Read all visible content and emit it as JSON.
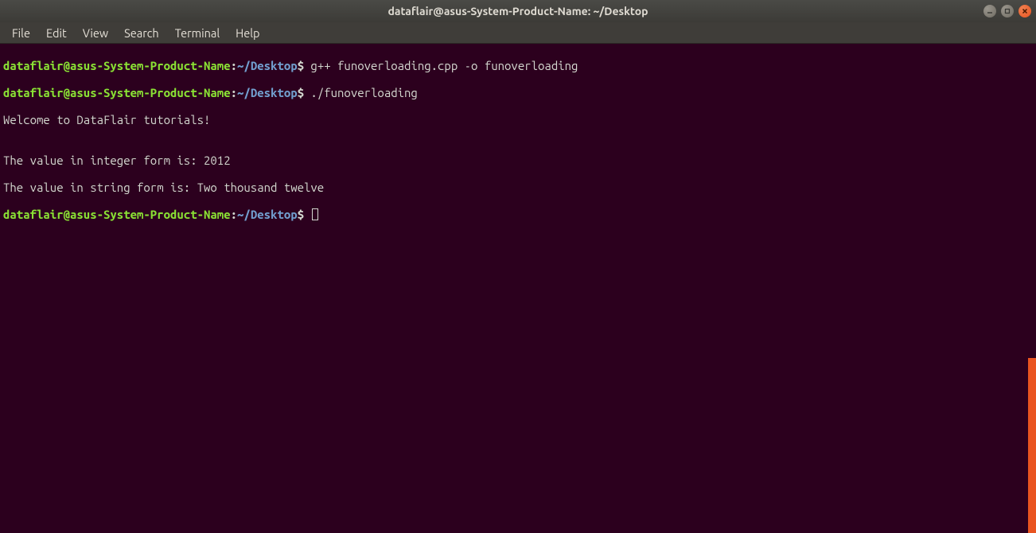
{
  "titlebar": {
    "title": "dataflair@asus-System-Product-Name: ~/Desktop"
  },
  "menubar": {
    "items": [
      "File",
      "Edit",
      "View",
      "Search",
      "Terminal",
      "Help"
    ]
  },
  "prompt": {
    "userhost": "dataflair@asus-System-Product-Name",
    "colon": ":",
    "tilde": "~",
    "path": "/Desktop",
    "dollar": "$"
  },
  "lines": {
    "cmd1": " g++ funoverloading.cpp -o funoverloading",
    "cmd2": " ./funoverloading",
    "out1": "Welcome to DataFlair tutorials!",
    "out2": "",
    "out3": "The value in integer form is: 2012",
    "out4": "The value in string form is: Two thousand twelve",
    "cmd3": " "
  }
}
